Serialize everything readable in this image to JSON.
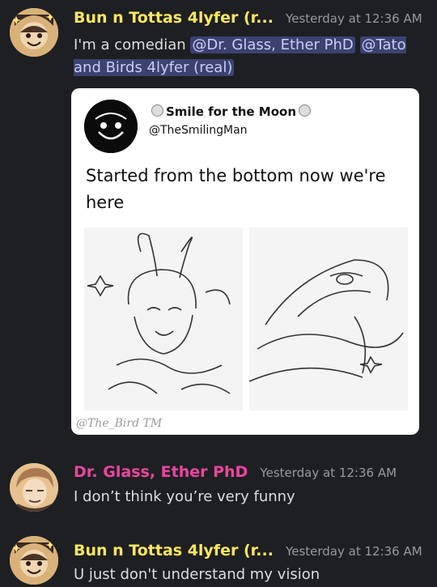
{
  "messages": [
    {
      "author": "Bun n Tottas 4lyfer (r...",
      "author_color": "#fee75c",
      "timestamp": "Yesterday at 12:36 AM",
      "text_prefix": "I'm a comedian ",
      "mentions": [
        "@Dr. Glass, Ether PhD",
        "@Tato and Birds 4lyfer (real)"
      ]
    },
    {
      "author": "Dr. Glass, Ether PhD",
      "author_color": "#eb459e",
      "timestamp": "Yesterday at 12:36 AM",
      "text": "I don’t think you’re very funny"
    },
    {
      "author": "Bun n Tottas 4lyfer (r...",
      "author_color": "#fee75c",
      "timestamp": "Yesterday at 12:36 AM",
      "text": "U just don't understand my vision"
    }
  ],
  "embed": {
    "display_name": "Smile for the Moon",
    "handle": "@TheSmilingMan",
    "text": "Started from the bottom now we're here",
    "images": [
      "sketch-left",
      "sketch-right"
    ],
    "watermark": "@The_Bird TM"
  }
}
